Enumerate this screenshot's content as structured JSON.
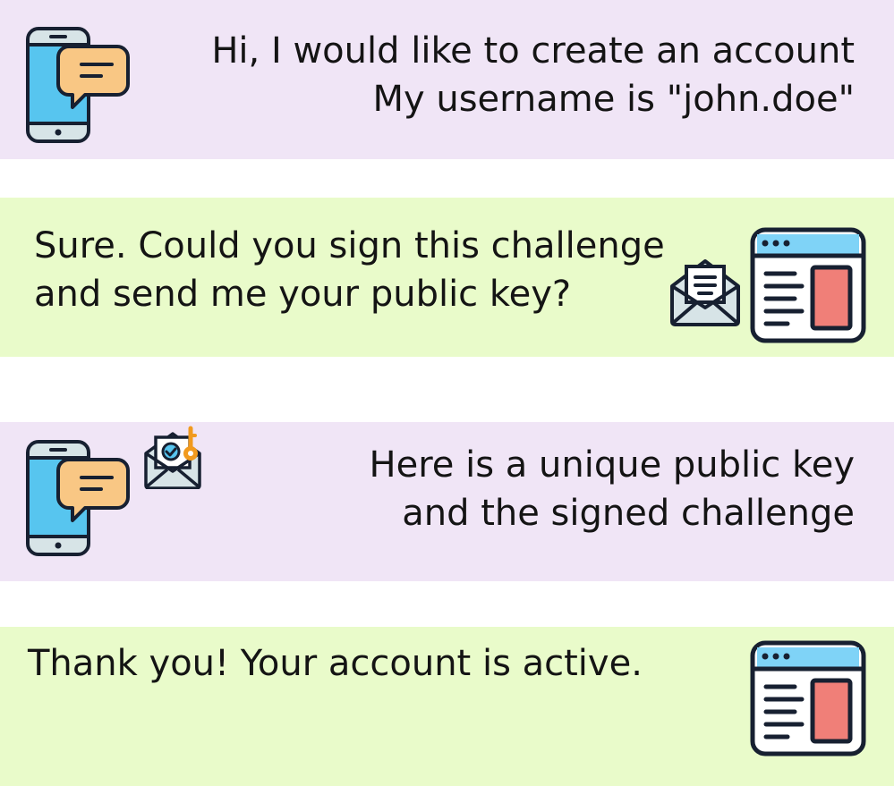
{
  "messages": [
    {
      "speaker": "user-device",
      "lines": [
        "Hi, I would like to create an account",
        "My username is \"john.doe\""
      ]
    },
    {
      "speaker": "server",
      "lines": [
        "Sure. Could you sign this challenge",
        "and send me your public key?"
      ]
    },
    {
      "speaker": "user-device",
      "lines": [
        "Here is a unique public key",
        "and the signed challenge"
      ]
    },
    {
      "speaker": "server",
      "lines": [
        "Thank you! Your account is active."
      ]
    }
  ],
  "icons": {
    "phone": "phone-chat-icon",
    "server": "browser-window-icon",
    "envelope": "open-envelope-letter-icon",
    "envelope_key": "envelope-key-check-icon"
  },
  "colors": {
    "user_panel": "#f0e5f6",
    "server_panel": "#e9fbca",
    "phone_screen": "#57c5ef",
    "chat_bubble": "#f9c784",
    "window_header": "#7fd3f7",
    "window_block": "#f07f78",
    "key": "#f19a1e",
    "outline": "#172031"
  }
}
